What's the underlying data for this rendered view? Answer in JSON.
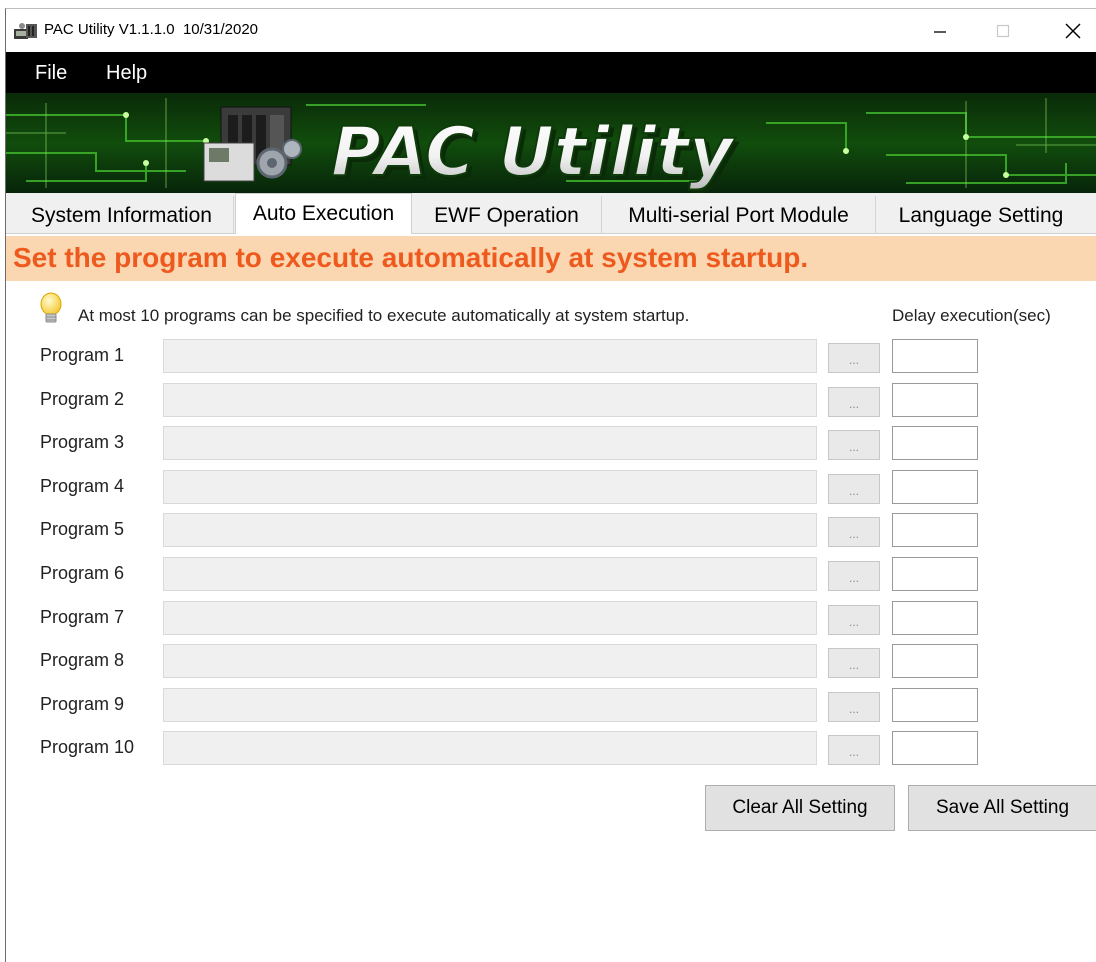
{
  "window": {
    "title": "PAC Utility V1.1.1.0  10/31/2020",
    "minimize_icon": "minimize-icon",
    "maximize_icon": "maximize-icon",
    "close_icon": "close-icon"
  },
  "menu": {
    "items": [
      {
        "label": "File"
      },
      {
        "label": "Help"
      }
    ]
  },
  "banner": {
    "logo_text": "PAC Utility",
    "accent_color": "#1e8a10"
  },
  "tabs": [
    {
      "label": "System Information",
      "active": false
    },
    {
      "label": "Auto Execution",
      "active": true
    },
    {
      "label": "EWF Operation",
      "active": false
    },
    {
      "label": "Multi-serial Port Module",
      "active": false
    },
    {
      "label": "Language Setting",
      "active": false
    }
  ],
  "auto_execution": {
    "instruction": "Set the program to execute automatically at system startup.",
    "hint": "At most 10 programs can be specified to execute automatically at system startup.",
    "delay_header": "Delay execution(sec)",
    "browse_label": "...",
    "programs": [
      {
        "label": "Program 1",
        "path": "",
        "delay": ""
      },
      {
        "label": "Program 2",
        "path": "",
        "delay": ""
      },
      {
        "label": "Program 3",
        "path": "",
        "delay": ""
      },
      {
        "label": "Program 4",
        "path": "",
        "delay": ""
      },
      {
        "label": "Program 5",
        "path": "",
        "delay": ""
      },
      {
        "label": "Program 6",
        "path": "",
        "delay": ""
      },
      {
        "label": "Program 7",
        "path": "",
        "delay": ""
      },
      {
        "label": "Program 8",
        "path": "",
        "delay": ""
      },
      {
        "label": "Program 9",
        "path": "",
        "delay": ""
      },
      {
        "label": "Program 10",
        "path": "",
        "delay": ""
      }
    ],
    "clear_button": "Clear All Setting",
    "save_button": "Save All Setting"
  },
  "colors": {
    "instruction_text": "#ee5a1e",
    "instruction_bg": "#fad7b0",
    "menubar_bg": "#000000"
  }
}
